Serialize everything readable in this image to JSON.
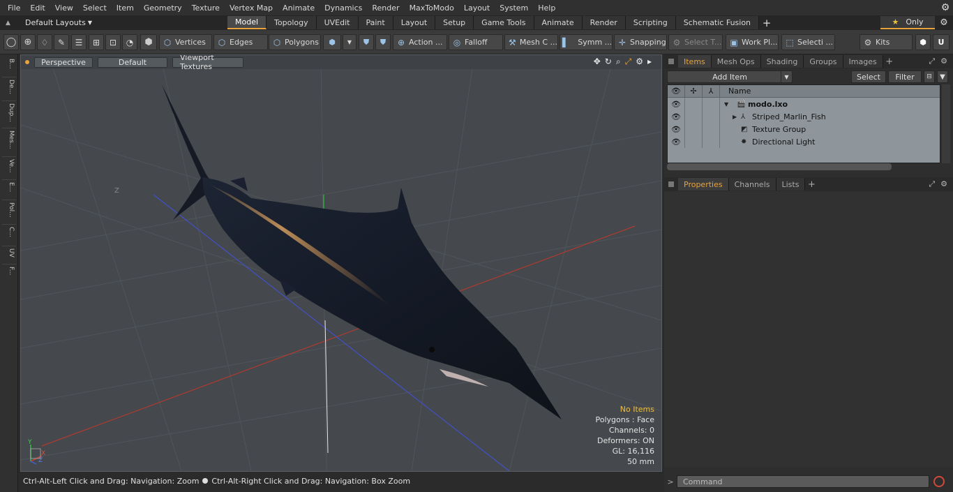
{
  "menubar": {
    "items": [
      "File",
      "Edit",
      "View",
      "Select",
      "Item",
      "Geometry",
      "Texture",
      "Vertex Map",
      "Animate",
      "Dynamics",
      "Render",
      "MaxToModo",
      "Layout",
      "System",
      "Help"
    ]
  },
  "tabbar": {
    "layout_label": "Default Layouts",
    "tabs": [
      "Model",
      "Topology",
      "UVEdit",
      "Paint",
      "Layout",
      "Setup",
      "Game Tools",
      "Animate",
      "Render",
      "Scripting",
      "Schematic Fusion"
    ],
    "active_tab": "Model",
    "only_label": "Only"
  },
  "toolbar": {
    "vertices": "Vertices",
    "edges": "Edges",
    "polygons": "Polygons",
    "action": "Action ...",
    "falloff": "Falloff",
    "mesh": "Mesh C ...",
    "symm": "Symm ...",
    "snapping": "Snapping",
    "select_t": "Select T...",
    "workpl": "Work Pl...",
    "selecti": "Selecti ...",
    "kits": "Kits"
  },
  "leftbar": {
    "tabs": [
      "B...",
      "De...",
      "Dup...",
      "Mes...",
      "Ve...",
      "E...",
      "Pol...",
      "C...",
      "UV",
      "F..."
    ]
  },
  "viewport": {
    "view_mode": "Perspective",
    "shading": "Default",
    "textures": "Viewport Textures",
    "axis_label": "Z",
    "stats": {
      "items": "No Items",
      "polygons": "Polygons : Face",
      "channels": "Channels: 0",
      "deformers": "Deformers: ON",
      "gl": "GL: 16,116",
      "focal": "50 mm"
    },
    "gizmo": {
      "y": "Y",
      "x": "X",
      "z": "Z"
    }
  },
  "statusbar": {
    "hint1": "Ctrl-Alt-Left Click and Drag: Navigation: Zoom",
    "hint2": "Ctrl-Alt-Right Click and Drag: Navigation: Box Zoom"
  },
  "items_panel": {
    "tabs": [
      "Items",
      "Mesh Ops",
      "Shading",
      "Groups",
      "Images"
    ],
    "active_tab": "Items",
    "add_item": "Add Item",
    "select": "Select",
    "filter": "Filter",
    "name_header": "Name",
    "tree": [
      {
        "name": "modo.lxo",
        "icon": "scene-icon"
      },
      {
        "name": "Striped_Marlin_Fish",
        "icon": "mesh-icon"
      },
      {
        "name": "Texture Group",
        "icon": "texture-group-icon"
      },
      {
        "name": "Directional Light",
        "icon": "light-icon"
      }
    ]
  },
  "properties_panel": {
    "tabs": [
      "Properties",
      "Channels",
      "Lists"
    ],
    "active_tab": "Properties"
  },
  "command": {
    "placeholder": "Command"
  },
  "colors": {
    "accent": "#e8a33c",
    "viewport_bg": "#45494d",
    "tree_bg": "#8e969c"
  }
}
